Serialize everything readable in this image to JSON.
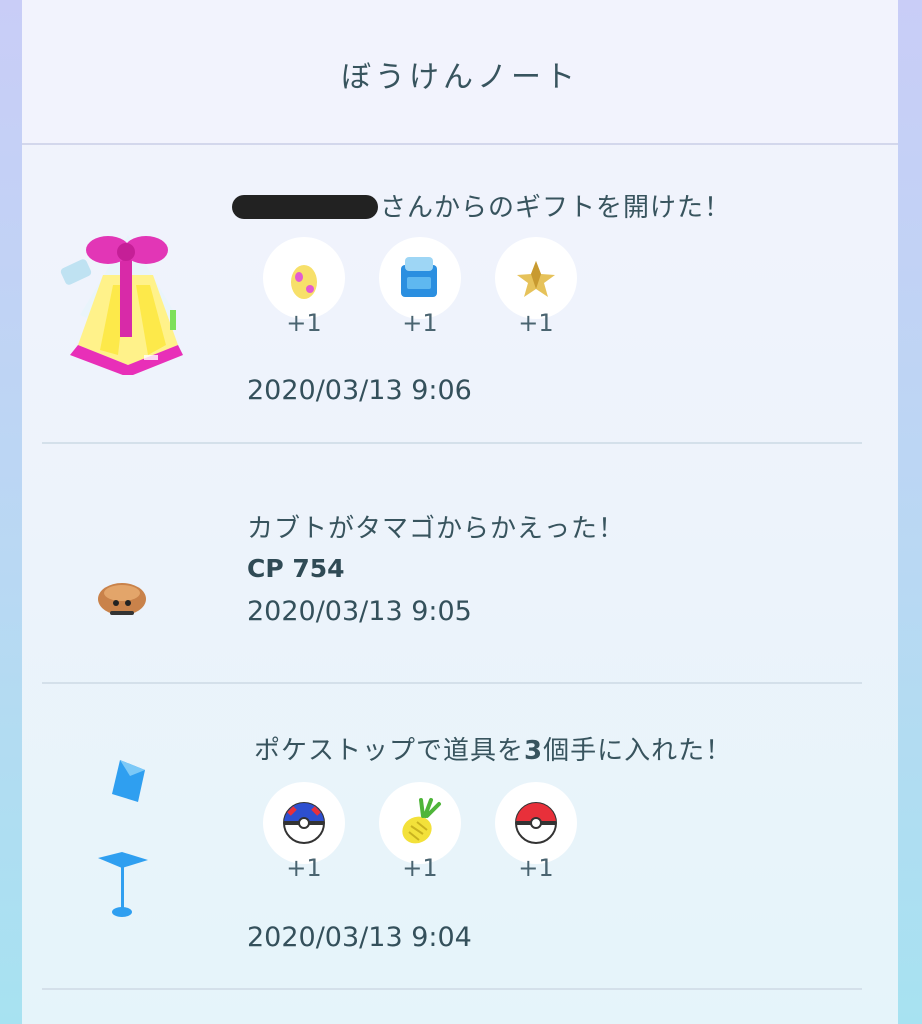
{
  "header": {
    "title": "ぼうけんノート"
  },
  "entries": [
    {
      "message": "さんからのギフトを開けた！",
      "items": [
        {
          "icon": "egg-icon",
          "count": "+1"
        },
        {
          "icon": "backpack-icon",
          "count": "+1"
        },
        {
          "icon": "stardust-icon",
          "count": "+1"
        }
      ],
      "date": "2020/03/13 9:06"
    },
    {
      "message": "カブトがタマゴからかえった！",
      "cp": "CP 754",
      "date": "2020/03/13 9:05"
    },
    {
      "message_prefix": "ポケストップで道具を",
      "message_count": "3",
      "message_suffix": "個手に入れた！",
      "items": [
        {
          "icon": "great-ball-icon",
          "count": "+1"
        },
        {
          "icon": "pinap-berry-icon",
          "count": "+1"
        },
        {
          "icon": "poke-ball-icon",
          "count": "+1"
        }
      ],
      "date": "2020/03/13 9:04"
    }
  ],
  "colors": {
    "text": "#38545e",
    "panel": "#eef3fc",
    "divider": "#d4e0ea"
  }
}
